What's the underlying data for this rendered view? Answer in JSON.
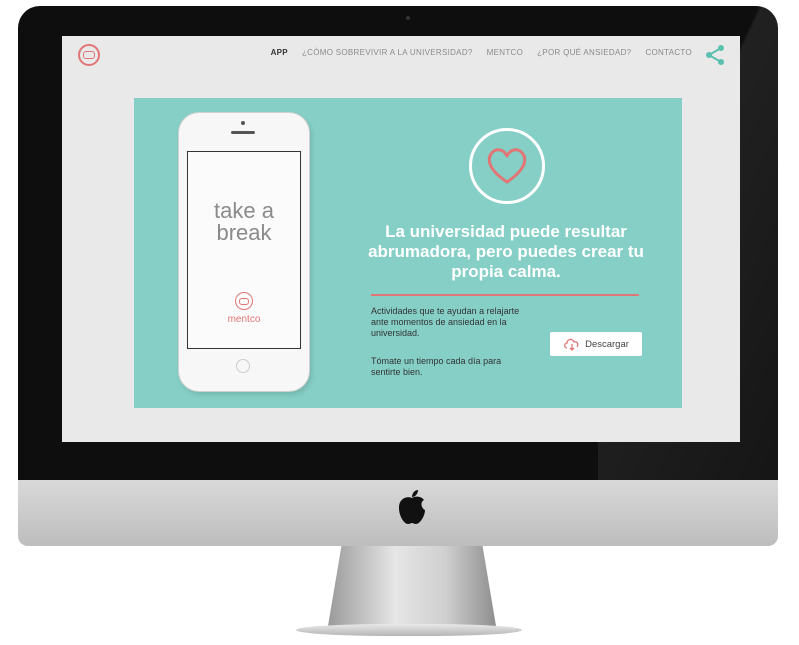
{
  "nav": {
    "items": [
      {
        "label": "APP",
        "active": true
      },
      {
        "label": "¿CÓMO SOBREVIVIR A LA UNIVERSIDAD?",
        "active": false
      },
      {
        "label": "MENTCO",
        "active": false
      },
      {
        "label": "¿POR QUÉ ANSIEDAD?",
        "active": false
      },
      {
        "label": "CONTACTO",
        "active": false
      }
    ]
  },
  "phone": {
    "title": "take a break",
    "brand": "mentco"
  },
  "hero": {
    "headline": "La universidad puede resultar abrumadora, pero puedes crear tu propia calma.",
    "description_1": "Actividades que te ayudan a relajarte ante momentos de ansiedad en la universidad.",
    "description_2": "Tómate un tiempo cada día para sentirte bien.",
    "download_label": "Descargar"
  },
  "colors": {
    "accent": "#e07676",
    "panel": "#85cfc6",
    "screen_bg": "#e9e9e9"
  },
  "icons": {
    "logo": "mentco-logo-icon",
    "share": "share-icon",
    "heart": "heart-icon",
    "download": "cloud-download-icon",
    "apple": "apple-logo-icon"
  }
}
